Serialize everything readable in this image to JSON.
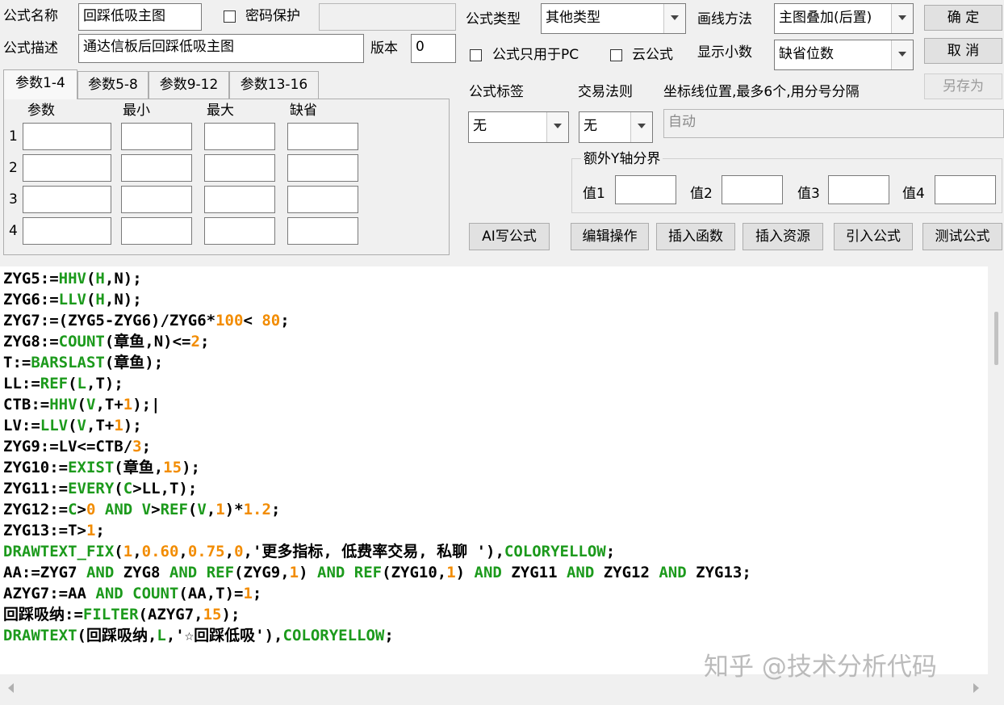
{
  "form": {
    "name_label": "公式名称",
    "name_value": "回踩低吸主图",
    "password_label": "密码保护",
    "desc_label": "公式描述",
    "desc_value": "通达信板后回踩低吸主图",
    "version_label": "版本",
    "version_value": "0",
    "type_label": "公式类型",
    "type_value": "其他类型",
    "draw_label": "画线方法",
    "draw_value": "主图叠加(后置)",
    "pc_only_label": "公式只用于PC",
    "cloud_label": "云公式",
    "decimal_label": "显示小数",
    "decimal_value": "缺省位数",
    "tag_label": "公式标签",
    "tag_value": "无",
    "rule_label": "交易法则",
    "rule_value": "无",
    "axis_label": "坐标线位置,最多6个,用分号分隔",
    "axis_placeholder": "自动",
    "extra_y_label": "额外Y轴分界",
    "val1": "值1",
    "val2": "值2",
    "val3": "值3",
    "val4": "值4"
  },
  "buttons": {
    "ok": "确  定",
    "cancel": "取  消",
    "save_as": "另存为",
    "ai": "AI写公式",
    "edit": "编辑操作",
    "insert_fn": "插入函数",
    "insert_res": "插入资源",
    "import": "引入公式",
    "test": "测试公式"
  },
  "tabs": [
    "参数1-4",
    "参数5-8",
    "参数9-12",
    "参数13-16"
  ],
  "params": {
    "headers": [
      "参数",
      "最小",
      "最大",
      "缺省"
    ],
    "rows": [
      "1",
      "2",
      "3",
      "4"
    ]
  },
  "code": [
    [
      [
        "t",
        "ZYG5:="
      ],
      [
        "f",
        "HHV"
      ],
      [
        "t",
        "("
      ],
      [
        "f",
        "H"
      ],
      [
        "t",
        ",N);"
      ]
    ],
    [
      [
        "t",
        "ZYG6:="
      ],
      [
        "f",
        "LLV"
      ],
      [
        "t",
        "("
      ],
      [
        "f",
        "H"
      ],
      [
        "t",
        ",N);"
      ]
    ],
    [
      [
        "t",
        "ZYG7:=(ZYG5-ZYG6)/ZYG6*"
      ],
      [
        "n",
        "100"
      ],
      [
        "t",
        "< "
      ],
      [
        "n",
        "80"
      ],
      [
        "t",
        ";"
      ]
    ],
    [
      [
        "t",
        "ZYG8:="
      ],
      [
        "f",
        "COUNT"
      ],
      [
        "t",
        "(章鱼,N)<="
      ],
      [
        "n",
        "2"
      ],
      [
        "t",
        ";"
      ]
    ],
    [
      [
        "t",
        "T:="
      ],
      [
        "f",
        "BARSLAST"
      ],
      [
        "t",
        "(章鱼);"
      ]
    ],
    [
      [
        "t",
        "LL:="
      ],
      [
        "f",
        "REF"
      ],
      [
        "t",
        "("
      ],
      [
        "f",
        "L"
      ],
      [
        "t",
        ",T);"
      ]
    ],
    [
      [
        "t",
        "CTB:="
      ],
      [
        "f",
        "HHV"
      ],
      [
        "t",
        "("
      ],
      [
        "f",
        "V"
      ],
      [
        "t",
        ",T+"
      ],
      [
        "n",
        "1"
      ],
      [
        "t",
        ");|"
      ]
    ],
    [
      [
        "t",
        "LV:="
      ],
      [
        "f",
        "LLV"
      ],
      [
        "t",
        "("
      ],
      [
        "f",
        "V"
      ],
      [
        "t",
        ",T+"
      ],
      [
        "n",
        "1"
      ],
      [
        "t",
        ");"
      ]
    ],
    [
      [
        "t",
        "ZYG9:=LV<=CTB/"
      ],
      [
        "n",
        "3"
      ],
      [
        "t",
        ";"
      ]
    ],
    [
      [
        "t",
        "ZYG10:="
      ],
      [
        "f",
        "EXIST"
      ],
      [
        "t",
        "(章鱼,"
      ],
      [
        "n",
        "15"
      ],
      [
        "t",
        ");"
      ]
    ],
    [
      [
        "t",
        "ZYG11:="
      ],
      [
        "f",
        "EVERY"
      ],
      [
        "t",
        "("
      ],
      [
        "f",
        "C"
      ],
      [
        "t",
        ">LL,T);"
      ]
    ],
    [
      [
        "t",
        "ZYG12:="
      ],
      [
        "f",
        "C"
      ],
      [
        "t",
        ">"
      ],
      [
        "n",
        "0"
      ],
      [
        "t",
        " "
      ],
      [
        "f",
        "AND"
      ],
      [
        "t",
        " "
      ],
      [
        "f",
        "V"
      ],
      [
        "t",
        ">"
      ],
      [
        "f",
        "REF"
      ],
      [
        "t",
        "("
      ],
      [
        "f",
        "V"
      ],
      [
        "t",
        ","
      ],
      [
        "n",
        "1"
      ],
      [
        "t",
        ")*"
      ],
      [
        "n",
        "1.2"
      ],
      [
        "t",
        ";"
      ]
    ],
    [
      [
        "t",
        "ZYG13:=T>"
      ],
      [
        "n",
        "1"
      ],
      [
        "t",
        ";"
      ]
    ],
    [
      [
        "f",
        "DRAWTEXT_FIX"
      ],
      [
        "t",
        "("
      ],
      [
        "n",
        "1"
      ],
      [
        "t",
        ","
      ],
      [
        "n",
        "0.60"
      ],
      [
        "t",
        ","
      ],
      [
        "n",
        "0.75"
      ],
      [
        "t",
        ","
      ],
      [
        "n",
        "0"
      ],
      [
        "t",
        ",'更多指标, 低费率交易, 私聊 '),"
      ],
      [
        "f",
        "COLORYELLOW"
      ],
      [
        "t",
        ";"
      ]
    ],
    [
      [
        "t",
        "AA:=ZYG7 "
      ],
      [
        "f",
        "AND"
      ],
      [
        "t",
        " ZYG8 "
      ],
      [
        "f",
        "AND"
      ],
      [
        "t",
        " "
      ],
      [
        "f",
        "REF"
      ],
      [
        "t",
        "(ZYG9,"
      ],
      [
        "n",
        "1"
      ],
      [
        "t",
        ") "
      ],
      [
        "f",
        "AND"
      ],
      [
        "t",
        " "
      ],
      [
        "f",
        "REF"
      ],
      [
        "t",
        "(ZYG10,"
      ],
      [
        "n",
        "1"
      ],
      [
        "t",
        ") "
      ],
      [
        "f",
        "AND"
      ],
      [
        "t",
        " ZYG11 "
      ],
      [
        "f",
        "AND"
      ],
      [
        "t",
        " ZYG12 "
      ],
      [
        "f",
        "AND"
      ],
      [
        "t",
        " ZYG13;"
      ]
    ],
    [
      [
        "t",
        "AZYG7:=AA "
      ],
      [
        "f",
        "AND"
      ],
      [
        "t",
        " "
      ],
      [
        "f",
        "COUNT"
      ],
      [
        "t",
        "(AA,T)="
      ],
      [
        "n",
        "1"
      ],
      [
        "t",
        ";"
      ]
    ],
    [
      [
        "t",
        "回踩吸纳:="
      ],
      [
        "f",
        "FILTER"
      ],
      [
        "t",
        "(AZYG7,"
      ],
      [
        "n",
        "15"
      ],
      [
        "t",
        ");"
      ]
    ],
    [
      [
        "f",
        "DRAWTEXT"
      ],
      [
        "t",
        "(回踩吸纳,"
      ],
      [
        "f",
        "L"
      ],
      [
        "t",
        ",'☆回踩低吸'),"
      ],
      [
        "f",
        "COLORYELLOW"
      ],
      [
        "t",
        ";"
      ]
    ]
  ],
  "watermark": "知乎 @技术分析代码"
}
